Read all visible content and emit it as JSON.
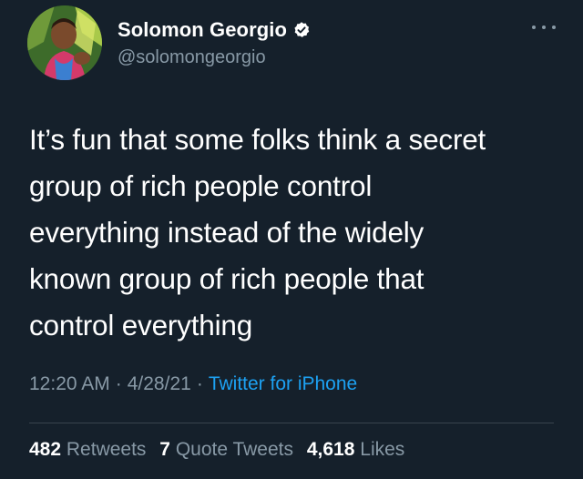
{
  "author": {
    "display_name": "Solomon Georgio",
    "handle": "@solomongeorgio",
    "verified": true,
    "avatar_icon": "profile-photo"
  },
  "tweet": {
    "lines": [
      "It’s fun that some folks think a secret",
      "group of rich people control",
      "everything instead of the widely",
      "known group of rich people that",
      "control everything"
    ],
    "time": "12:20 AM",
    "date": "4/28/21",
    "separator": "·",
    "source": "Twitter for iPhone"
  },
  "stats": {
    "retweets_count": "482",
    "retweets_label": "Retweets",
    "quote_count": "7",
    "quote_label": "Quote Tweets",
    "likes_count": "4,618",
    "likes_label": "Likes"
  },
  "colors": {
    "background": "#15202b",
    "secondary_text": "#8899a6",
    "link": "#1da1f2",
    "divider": "#38444d"
  }
}
